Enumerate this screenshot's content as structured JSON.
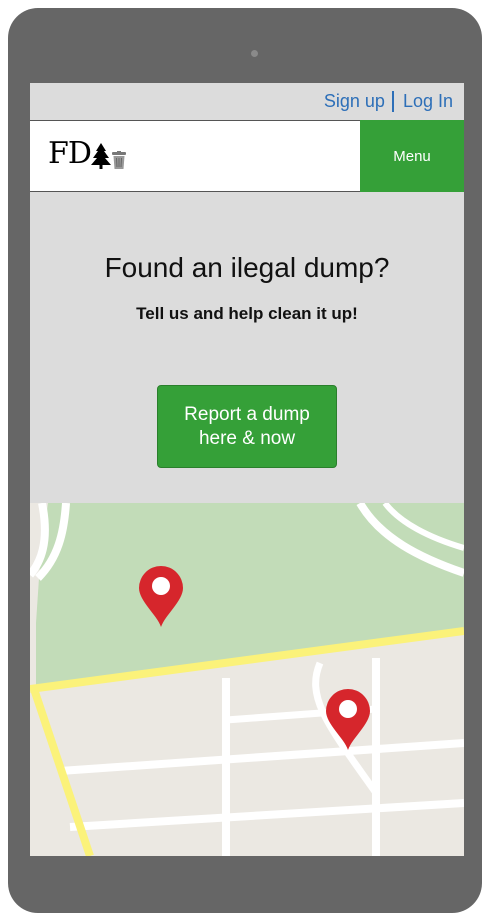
{
  "topbar": {
    "signup_label": "Sign up",
    "login_label": "Log In"
  },
  "header": {
    "logo_text": "FD",
    "menu_label": "Menu"
  },
  "hero": {
    "title": "Found an ilegal dump?",
    "subtitle": "Tell us and help clean it up!",
    "cta_label": "Report a dump\nhere & now"
  },
  "map": {
    "markers": [
      "map-pin-icon",
      "map-pin-icon"
    ]
  },
  "colors": {
    "accent_green": "#35a038",
    "link_blue": "#2d6fb8",
    "pin_red": "#d6262c",
    "park_green": "#c2dcb8",
    "road_yellow": "#fbf27a"
  }
}
